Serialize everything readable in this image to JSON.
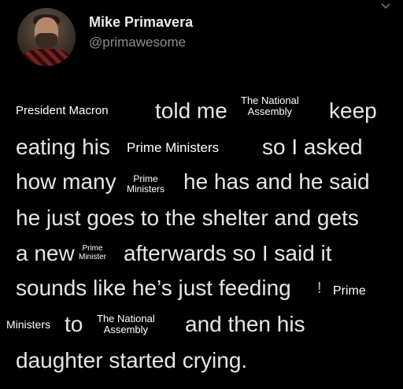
{
  "author": {
    "name": "Mike Primavera",
    "handle": "@primawesome"
  },
  "tweet": {
    "line1": {
      "sticker_president": "President Macron",
      "text_told": "told me",
      "sticker_assembly_top": "The National",
      "sticker_assembly_bottom": "Assembly",
      "text_keep": "keep"
    },
    "line2": {
      "text_eating": "eating his",
      "sticker_prime_ministers": "Prime Ministers",
      "text_so": "so I asked"
    },
    "line3": {
      "text_how": "how many",
      "sticker_prime_top": "Prime",
      "sticker_prime_bottom": "Ministers",
      "text_he": "he has and he said"
    },
    "line4": {
      "text": "he just goes to the shelter and gets"
    },
    "line5": {
      "text_anew": "a new",
      "sticker_pm_top": "Prime",
      "sticker_pm_bottom": "Minister",
      "text_after": "afterwards so I said it"
    },
    "line6": {
      "text_sounds": "sounds like he’s just feeding",
      "text_partial": "!",
      "sticker_prime": "Prime"
    },
    "line7": {
      "sticker_ministers": "Ministers",
      "text_to": "to",
      "sticker_assembly_top": "The National",
      "sticker_assembly_bottom": "Assembly",
      "text_then": "and then his"
    },
    "line8": {
      "text": "daughter started crying."
    }
  },
  "icons": {
    "menu": "chevron-down-icon"
  }
}
